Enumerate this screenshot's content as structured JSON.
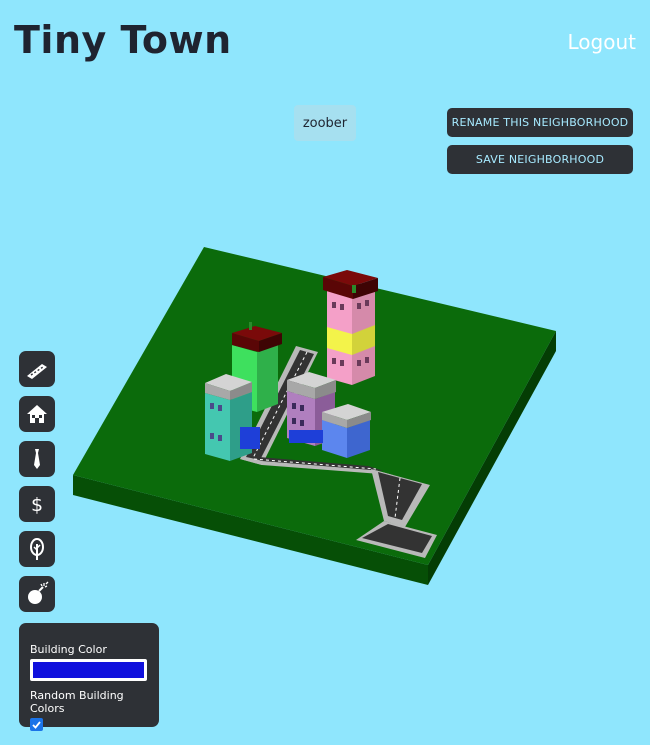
{
  "header": {
    "title": "Tiny Town",
    "logout_label": "Logout"
  },
  "neighborhood": {
    "name": "zoober",
    "rename_label": "RENAME THIS NEIGHBORHOOD",
    "save_label": "SAVE NEIGHBORHOOD"
  },
  "toolbar": {
    "tools": [
      {
        "name": "road-tool",
        "icon": "road-icon"
      },
      {
        "name": "house-tool",
        "icon": "house-icon"
      },
      {
        "name": "office-tool",
        "icon": "tie-icon"
      },
      {
        "name": "commercial-tool",
        "icon": "dollar-icon"
      },
      {
        "name": "tree-tool",
        "icon": "tree-icon"
      },
      {
        "name": "demolish-tool",
        "icon": "bomb-icon"
      }
    ],
    "dollar_glyph": "$"
  },
  "settings": {
    "building_color_label": "Building Color",
    "building_color": "#1010dd",
    "random_colors_label": "Random Building Colors",
    "random_colors_checked": true
  },
  "colors": {
    "background": "#8fe6fd",
    "ground": "#0a6a0a",
    "ground_side": "#054d05",
    "button_bg": "#2e3136",
    "button_text": "#a7eaff"
  }
}
